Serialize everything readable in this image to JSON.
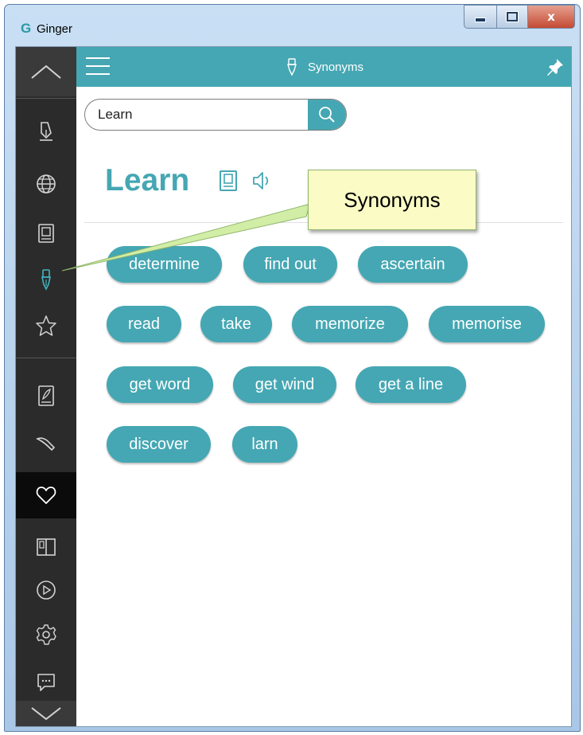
{
  "window": {
    "app_logo": "G",
    "title": "Ginger",
    "controls": {
      "close_glyph": "x"
    }
  },
  "sidebar": {
    "items": [
      {
        "name": "scroll-up",
        "icon": "chevron-up-icon"
      },
      {
        "name": "rephrase",
        "icon": "pen-nib-icon"
      },
      {
        "name": "translate",
        "icon": "globe-icon"
      },
      {
        "name": "dictionary",
        "icon": "dictionary-icon"
      },
      {
        "name": "synonyms",
        "icon": "fountain-pen-icon",
        "highlighted": true
      },
      {
        "name": "favorites",
        "icon": "star-icon"
      },
      {
        "name": "personal-trainer",
        "icon": "book-feather-icon"
      },
      {
        "name": "writing",
        "icon": "quill-icon"
      },
      {
        "name": "love",
        "icon": "heart-icon",
        "active": true
      },
      {
        "name": "reader",
        "icon": "open-book-icon"
      },
      {
        "name": "tutorial",
        "icon": "play-icon"
      },
      {
        "name": "settings",
        "icon": "gear-icon"
      },
      {
        "name": "feedback",
        "icon": "chat-icon"
      },
      {
        "name": "scroll-down",
        "icon": "chevron-down-icon"
      }
    ]
  },
  "topbar": {
    "title": "Synonyms",
    "menu_icon": "hamburger-icon",
    "pin_icon": "pin-icon"
  },
  "search": {
    "value": "Learn",
    "button_icon": "search-icon"
  },
  "entry": {
    "word": "Learn",
    "icons": [
      "dictionary-icon",
      "speaker-icon"
    ]
  },
  "synonyms": [
    "determine",
    "find out",
    "ascertain",
    "read",
    "take",
    "memorize",
    "memorise",
    "get word",
    "get wind",
    "get a line",
    "discover",
    "larn"
  ],
  "callout": {
    "text": "Synonyms"
  },
  "colors": {
    "accent": "#45a7b3",
    "sidebar_bg": "#2b2b2b",
    "callout_bg": "#fbfbc5"
  }
}
